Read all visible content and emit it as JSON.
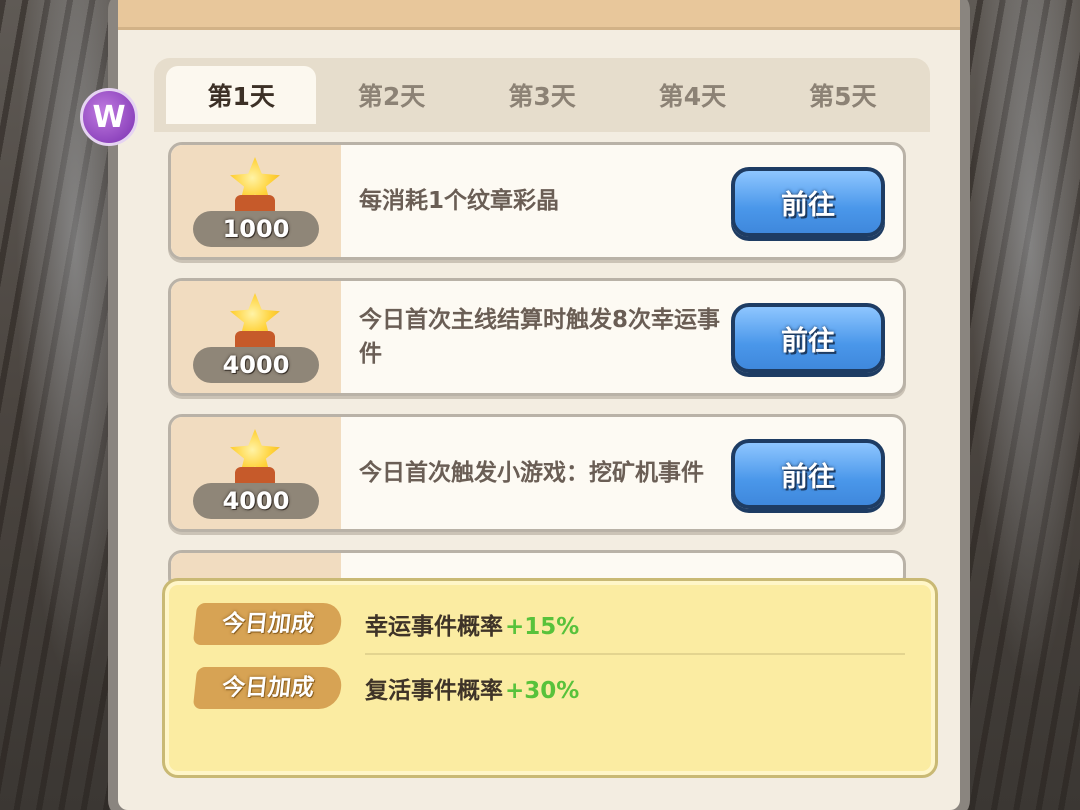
{
  "tabs": [
    {
      "label": "第1天",
      "active": true
    },
    {
      "label": "第2天",
      "active": false
    },
    {
      "label": "第3天",
      "active": false
    },
    {
      "label": "第4天",
      "active": false
    },
    {
      "label": "第5天",
      "active": false
    }
  ],
  "tasks": [
    {
      "reward": "1000",
      "description": "每消耗1个纹章彩晶",
      "button": "前往"
    },
    {
      "reward": "4000",
      "description": "今日首次主线结算时触发8次幸运事件",
      "button": "前往"
    },
    {
      "reward": "4000",
      "description": "今日首次触发小游戏：挖矿机事件",
      "button": "前往"
    }
  ],
  "bonus": {
    "rows": [
      {
        "tag": "今日加成",
        "text": "幸运事件概率",
        "value": "+15%"
      },
      {
        "tag": "今日加成",
        "text": "复活事件概率",
        "value": "+30%"
      }
    ]
  },
  "logo": {
    "glyph": "W"
  },
  "colors": {
    "accent_blue": "#4a97ea",
    "bonus_green": "#58c23b",
    "panel_bg": "#f3ede1",
    "bonus_bg": "#fbeca2"
  }
}
